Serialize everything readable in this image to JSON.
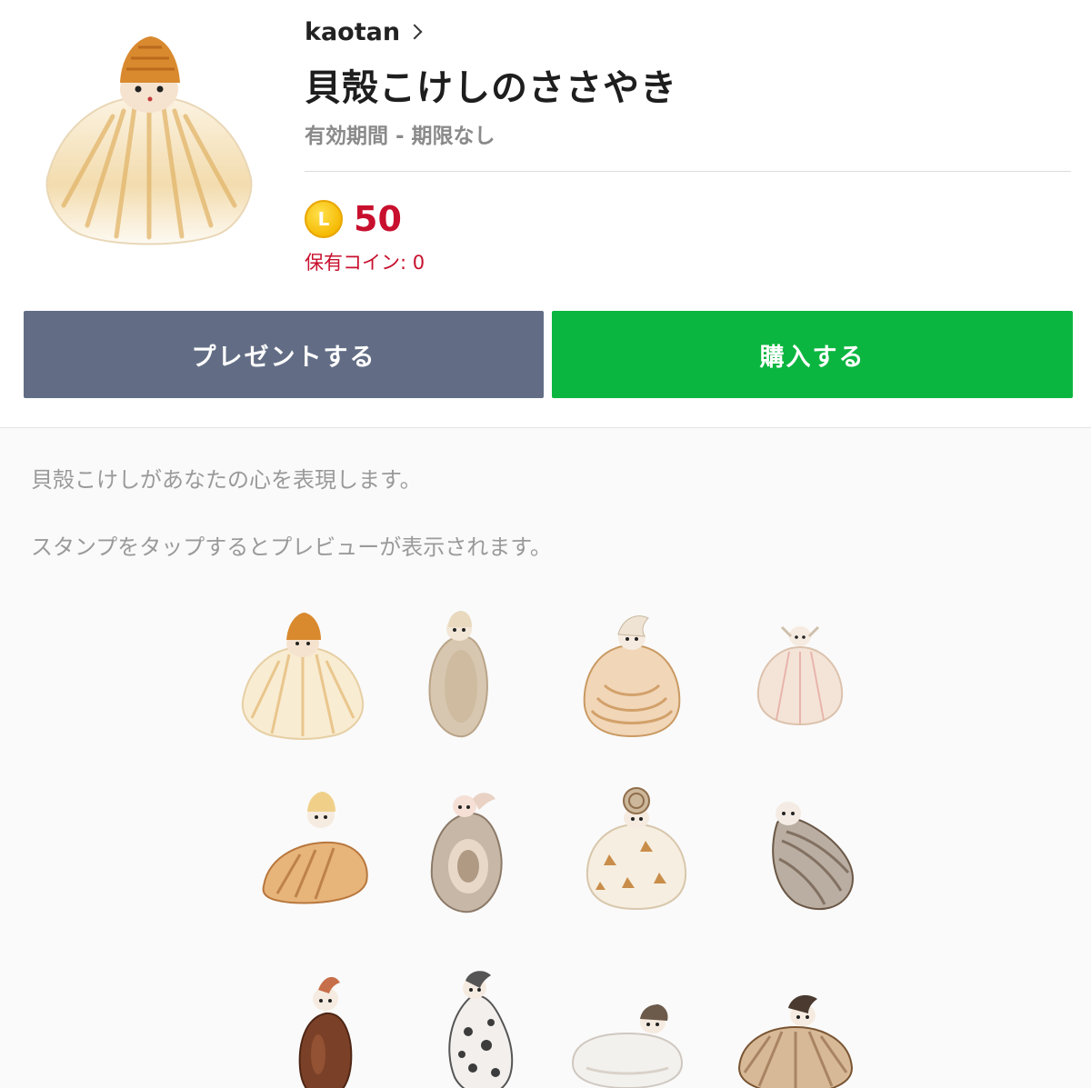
{
  "header": {
    "author": "kaotan",
    "title": "貝殻こけしのささやき",
    "validity": "有効期間 - 期限なし"
  },
  "price": {
    "coin_icon": "line-coin-icon",
    "coin_letter": "L",
    "amount": "50",
    "owned_coins": "保有コイン: 0"
  },
  "buttons": {
    "gift_label": "プレゼントする",
    "buy_label": "購入する"
  },
  "description": {
    "text": "貝殻こけしがあなたの心を表現します。",
    "hint": "スタンプをタップするとプレビューが表示されます。"
  },
  "colors": {
    "gift_button": "#626d85",
    "buy_button": "#0bb640",
    "price": "#c8102e"
  }
}
